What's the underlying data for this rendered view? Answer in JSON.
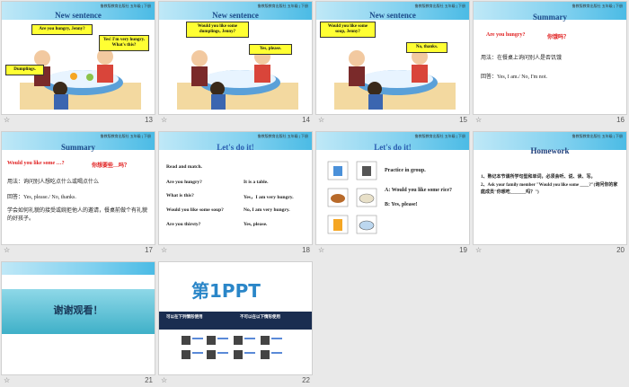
{
  "header_meta": "鲁教版教育出版社 五年级 | 下册",
  "slides": [
    {
      "num": "13",
      "title": "New sentence",
      "bubbles": [
        "Are you hungry, Jenny?",
        "Yes! I'm very hungry. What's this?",
        "Dumplings."
      ]
    },
    {
      "num": "14",
      "title": "New sentence",
      "bubbles": [
        "Would you like some dumplings, Jenny?",
        "Yes, please."
      ]
    },
    {
      "num": "15",
      "title": "New sentence",
      "bubbles": [
        "Would you like some soup, Jenny?",
        "No, thanks."
      ]
    },
    {
      "num": "16",
      "title": "Summary",
      "question_en": "Are you hungry?",
      "question_zh": "你饿吗？",
      "usage": "用法：在餐桌上询问别人是否饥饿",
      "answer": "回答：Yes, I am./ No, I'm not."
    },
    {
      "num": "17",
      "title": "Summary",
      "question_en": "Would you like some …?",
      "question_zh": "你想要些…吗？",
      "usage": "用法：询问别人想吃点什么或喝点什么",
      "answer": "回答：Yes, please./ No, thanks.",
      "note": "学会如何礼貌的接受或婉拒他人的邀请，餐桌前做个有礼貌的好孩子。"
    },
    {
      "num": "18",
      "title": "Let's do it!",
      "instruction": "Read and match.",
      "left": [
        "Are you hungry?",
        "What is this?",
        "Would you like some soup?",
        "Are you thirsty?"
      ],
      "right": [
        "It is a table.",
        "Yes，I am very hungry.",
        "No, I am very hungry.",
        "Yes, please."
      ]
    },
    {
      "num": "19",
      "title": "Let's do it!",
      "instruction": "Practice in group.",
      "line_a": "A: Would you like some rice?",
      "line_b": "B: Yes, please!"
    },
    {
      "num": "20",
      "title": "Homework",
      "item1": "1、熟记本节课所学句型和单词，必须会听、说、读、写。",
      "item2": "2、Ask your family member \"Would you like some ____?\"(询问你的家庭成员\"你想吃_______吗？\")"
    },
    {
      "num": "21",
      "title": "谢谢观看！"
    },
    {
      "num": "22",
      "logo": "第1PPT",
      "col1_title": "可以在下列情形使用",
      "col2_title": "不可以在以下情形使用"
    }
  ],
  "star_glyph": "☆"
}
